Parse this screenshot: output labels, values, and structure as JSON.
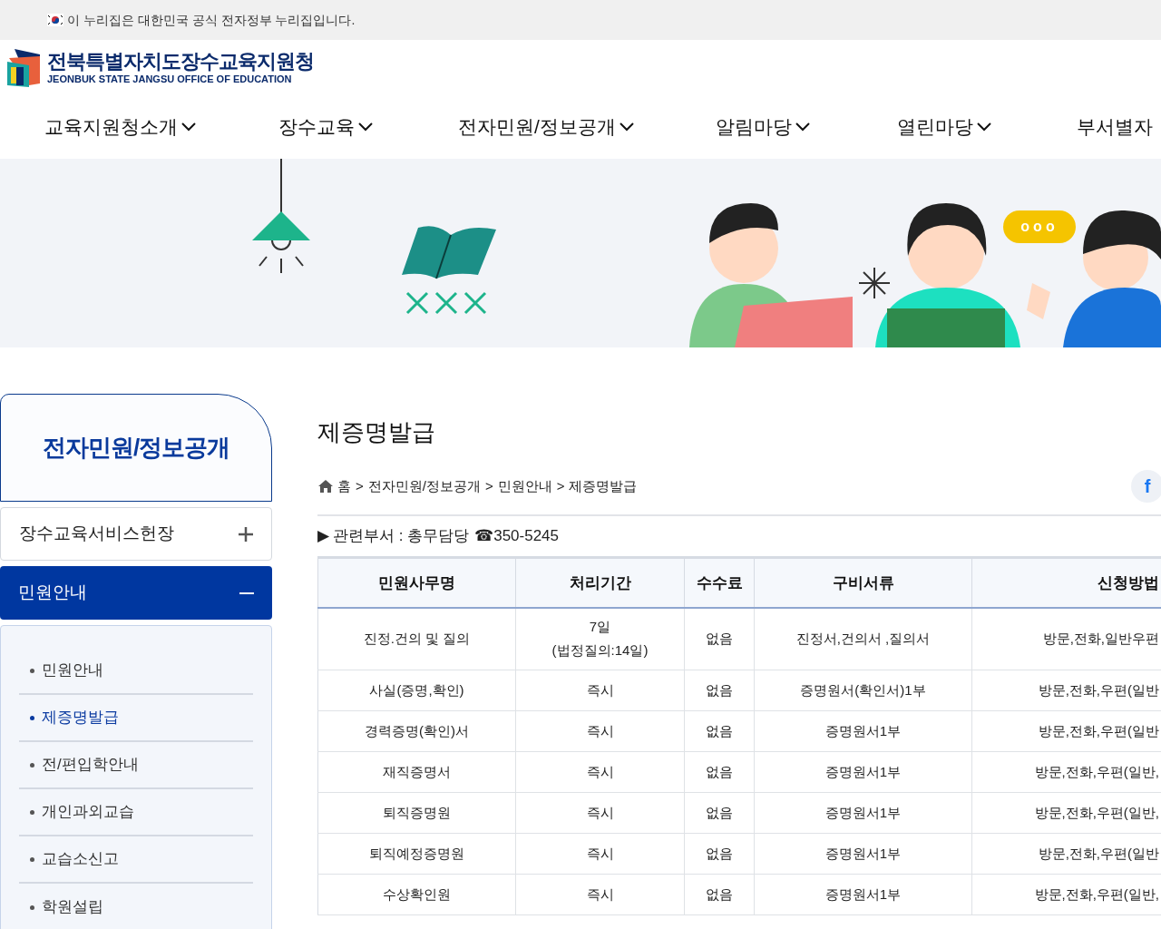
{
  "gov_banner": {
    "text": "이 누리집은 대한민국 공식 전자정부 누리집입니다."
  },
  "logo": {
    "name": "전북특별자치도장수교육지원청",
    "subtitle": "JEONBUK STATE JANGSU OFFICE OF EDUCATION"
  },
  "nav": [
    {
      "label": "교육지원청소개",
      "kind": "dropdown"
    },
    {
      "label": "장수교육",
      "kind": "dropdown"
    },
    {
      "label": "전자민원/정보공개",
      "kind": "dropdown"
    },
    {
      "label": "알림마당",
      "kind": "dropdown"
    },
    {
      "label": "열린마당",
      "kind": "dropdown"
    },
    {
      "label": "부서별자",
      "kind": "link"
    }
  ],
  "speech_bubble": {
    "text": "ooo"
  },
  "sidebar": {
    "title": "전자민원/정보공개",
    "groups": [
      {
        "label": "장수교육서비스헌장",
        "expanded": false
      },
      {
        "label": "민원안내",
        "expanded": true,
        "children": [
          {
            "label": "민원안내",
            "selected": false
          },
          {
            "label": "제증명발급",
            "selected": true
          },
          {
            "label": "전/편입학안내",
            "selected": false
          },
          {
            "label": "개인과외교습",
            "selected": false
          },
          {
            "label": "교습소신고",
            "selected": false
          },
          {
            "label": "학원설립",
            "selected": false
          }
        ]
      }
    ]
  },
  "page": {
    "title": "제증명발급",
    "breadcrumb": {
      "items": [
        "홈",
        "전자민원/정보공개",
        "민원안내",
        "제증명발급"
      ],
      "separator": ">"
    },
    "share_button": {
      "label": "f"
    },
    "department": {
      "marker": "▶",
      "label": "관련부서 : 총무담당",
      "phone_icon": "☎",
      "phone": "350-5245"
    }
  },
  "table": {
    "columns": [
      "민원사무명",
      "처리기간",
      "수수료",
      "구비서류",
      "신청방법"
    ],
    "rows": [
      [
        "진정.건의 및 질의",
        "7일\n(법정질의:14일)",
        "없음",
        "진정서,건의서 ,질의서",
        "방문,전화,일반우편"
      ],
      [
        "사실(증명,확인)",
        "즉시",
        "없음",
        "증명원서(확인서)1부",
        "방문,전화,우편(일반"
      ],
      [
        "경력증명(확인)서",
        "즉시",
        "없음",
        "증명원서1부",
        "방문,전화,우편(일반"
      ],
      [
        "재직증명서",
        "즉시",
        "없음",
        "증명원서1부",
        "방문,전화,우편(일반,"
      ],
      [
        "퇴직증명원",
        "즉시",
        "없음",
        "증명원서1부",
        "방문,전화,우편(일반,"
      ],
      [
        "퇴직예정증명원",
        "즉시",
        "없음",
        "증명원서1부",
        "방문,전화,우편(일반"
      ],
      [
        "수상확인원",
        "즉시",
        "없음",
        "증명원서1부",
        "방문,전화,우편(일반,"
      ]
    ]
  }
}
